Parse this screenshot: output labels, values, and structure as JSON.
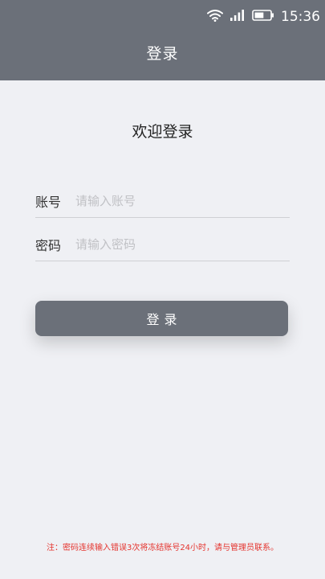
{
  "status_bar": {
    "time": "15:36",
    "icons": [
      "wifi-icon",
      "signal-icon",
      "battery-icon"
    ],
    "battery_level": 0.6
  },
  "header": {
    "title": "登录",
    "background": "#6b7079"
  },
  "main": {
    "welcome": "欢迎登录",
    "account": {
      "label": "账号",
      "placeholder": "请输入账号",
      "value": ""
    },
    "password": {
      "label": "密码",
      "placeholder": "请输入密码",
      "value": ""
    },
    "login_button": "登录"
  },
  "footer": {
    "note": "注：密码连续输入错误3次将冻结账号24小时，请与管理员联系。",
    "note_color": "#e5342e"
  }
}
